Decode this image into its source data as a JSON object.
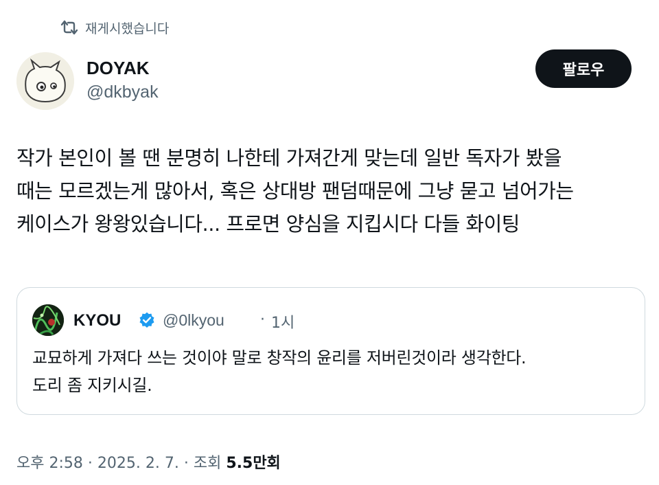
{
  "repost": {
    "label": "재게시했습니다",
    "icon": "repost-icon"
  },
  "author": {
    "name": "DOYAK",
    "handle": "@dkbyak",
    "avatar_icon": "ghost-cat-avatar"
  },
  "follow_button": {
    "label": "팔로우",
    "bg": "#0f1419",
    "fg": "#ffffff"
  },
  "post": {
    "lines": [
      "작가 본인이 볼 땐 분명히 나한테 가져간게 맞는데 일반 독자가 봤을",
      "때는 모르겠는게 많아서, 혹은 상대방 팬덤때문에 그냥 묻고 넘어가는",
      "케이스가 왕왕있습니다... 프로면 양심을 지킵시다 다들 화이팅"
    ]
  },
  "quote": {
    "name": "KYOU",
    "verified_icon": "verified-badge-icon",
    "verified_color": "#1d9bf0",
    "handle": "@0lkyou",
    "separator": "·",
    "time": "1시",
    "lines": [
      "교묘하게 가져다 쓰는 것이야 말로 창작의 윤리를 저버린것이라 생각한다.",
      "도리 좀 지키시길."
    ]
  },
  "meta": {
    "time": "오후 2:58",
    "sep1": "·",
    "date": "2025. 2. 7.",
    "sep2": "·",
    "views_label": "조회",
    "views_value": "5.5",
    "views_unit": "만회"
  },
  "colors": {
    "text": "#0f1419",
    "secondary": "#536471",
    "border": "#cfd9de"
  }
}
